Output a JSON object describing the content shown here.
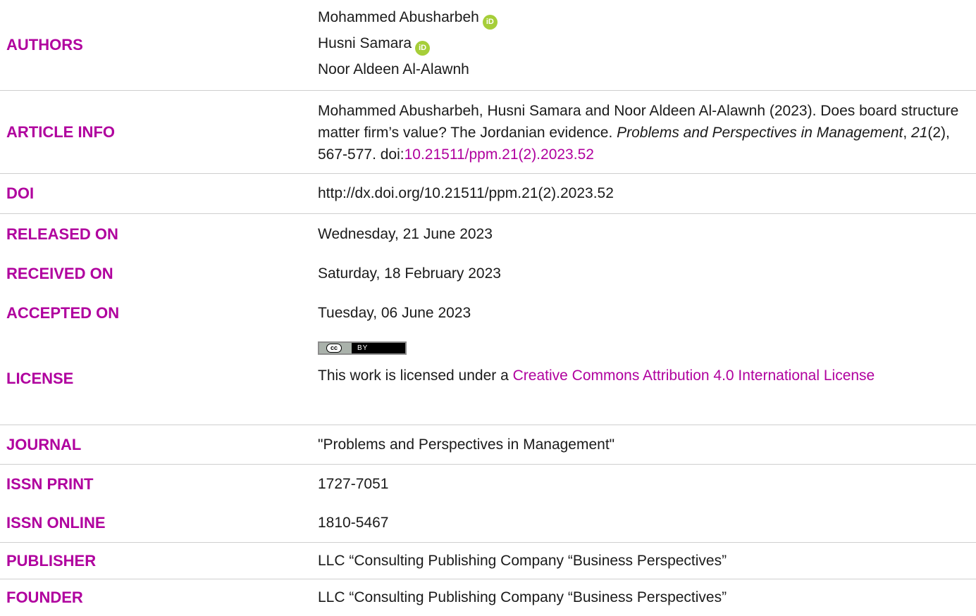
{
  "rows": {
    "authors": {
      "label": "AUTHORS",
      "names": [
        "Mohammed Abusharbeh",
        "Husni Samara",
        "Noor Aldeen Al-Alawnh"
      ]
    },
    "article_info": {
      "label": "ARTICLE INFO",
      "citation_part1": "Mohammed Abusharbeh, Husni Samara and Noor Aldeen Al-Alawnh (2023). Does board structure matter firm’s value? The Jordanian evidence. ",
      "journal_italic": "Problems and Perspectives in Management",
      "sep1": ", ",
      "volume_italic": "21",
      "issue_pages": "(2), 567-577. doi:",
      "doi_link": "10.21511/ppm.21(2).2023.52"
    },
    "doi": {
      "label": "DOI",
      "value": "http://dx.doi.org/10.21511/ppm.21(2).2023.52"
    },
    "released": {
      "label": "RELEASED ON",
      "value": "Wednesday, 21 June 2023"
    },
    "received": {
      "label": "RECEIVED ON",
      "value": "Saturday, 18 February 2023"
    },
    "accepted": {
      "label": "ACCEPTED ON",
      "value": "Tuesday, 06 June 2023"
    },
    "license": {
      "label": "LICENSE",
      "badge_cc": "cc",
      "badge_by": "BY",
      "text_prefix": "This work is licensed under a ",
      "link_text": "Creative Commons Attribution 4.0 International License"
    },
    "journal": {
      "label": "JOURNAL",
      "value": "\"Problems and Perspectives in Management\""
    },
    "issn_print": {
      "label": "ISSN PRINT",
      "value": "1727-7051"
    },
    "issn_online": {
      "label": "ISSN ONLINE",
      "value": "1810-5467"
    },
    "publisher": {
      "label": "PUBLISHER",
      "value": "LLC “Consulting Publishing Company “Business Perspectives”"
    },
    "founder": {
      "label": "FOUNDER",
      "value": "LLC “Consulting Publishing Company “Business Perspectives”"
    }
  },
  "icons": {
    "orcid": "orcid-icon",
    "orcid_text": "iD",
    "orcid_color": "#a6ce39"
  },
  "colors": {
    "accent": "#b0009e",
    "border": "#cfcfcf"
  }
}
